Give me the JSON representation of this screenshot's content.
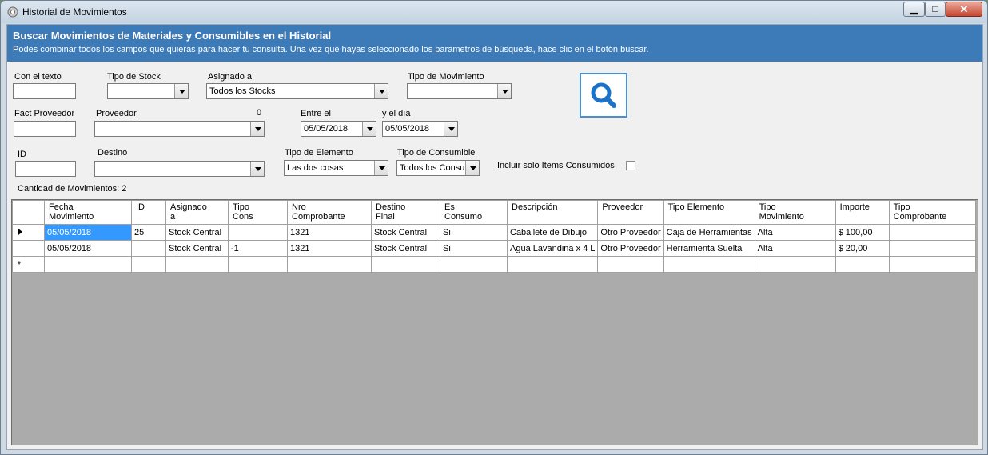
{
  "window": {
    "title": "Historial de Movimientos"
  },
  "banner": {
    "title": "Buscar Movimientos de Materiales y Consumibles en el Historial",
    "subtitle": "Podes combinar todos los campos que quieras para hacer tu consulta. Una vez que hayas seleccionado los parametros de búsqueda, hace clic en el botón buscar."
  },
  "filters": {
    "con_el_texto": {
      "label": "Con el texto",
      "value": ""
    },
    "tipo_stock": {
      "label": "Tipo de Stock",
      "value": ""
    },
    "asignado_a": {
      "label": "Asignado a",
      "value": "Todos los Stocks"
    },
    "tipo_movimiento": {
      "label": "Tipo de Movimiento",
      "value": ""
    },
    "fact_proveedor": {
      "label": "Fact Proveedor",
      "value": ""
    },
    "proveedor": {
      "label": "Proveedor",
      "value": "",
      "count": "0"
    },
    "entre_el": {
      "label": "Entre el",
      "value": "05/05/2018"
    },
    "y_el_dia": {
      "label": "y el día",
      "value": "05/05/2018"
    },
    "id": {
      "label": "ID",
      "value": ""
    },
    "destino": {
      "label": "Destino",
      "value": ""
    },
    "tipo_elemento": {
      "label": "Tipo de Elemento",
      "value": "Las dos cosas"
    },
    "tipo_consumible": {
      "label": "Tipo de Consumible",
      "value": "Todos los Consum"
    },
    "incluir_consumidos": {
      "label": "Incluir solo Items Consumidos",
      "checked": false
    }
  },
  "search_button": {
    "icon": "search-icon",
    "color": "#1a73c8"
  },
  "count_label": "Cantidad de Movimientos: 2",
  "grid": {
    "columns": [
      "Fecha\nMovimiento",
      "ID",
      "Asignado\na",
      "Tipo\nCons",
      "Nro\nComprobante",
      "Destino\nFinal",
      "Es\nConsumo",
      "Descripción",
      "Proveedor",
      "Tipo Elemento",
      "Tipo\nMovimiento",
      "Importe",
      "Tipo\nComprobante"
    ],
    "rows": [
      [
        "05/05/2018",
        "25",
        "Stock Central",
        "",
        "1321",
        "Stock Central",
        "Si",
        "Caballete de Dibujo",
        "Otro Proveedor",
        "Caja de Herramientas",
        "Alta",
        "$ 100,00",
        ""
      ],
      [
        "05/05/2018",
        "",
        "Stock Central",
        "-1",
        "1321",
        "Stock Central",
        "Si",
        "Agua Lavandina x 4 L",
        "Otro Proveedor",
        "Herramienta Suelta",
        "Alta",
        "$ 20,00",
        ""
      ]
    ]
  }
}
